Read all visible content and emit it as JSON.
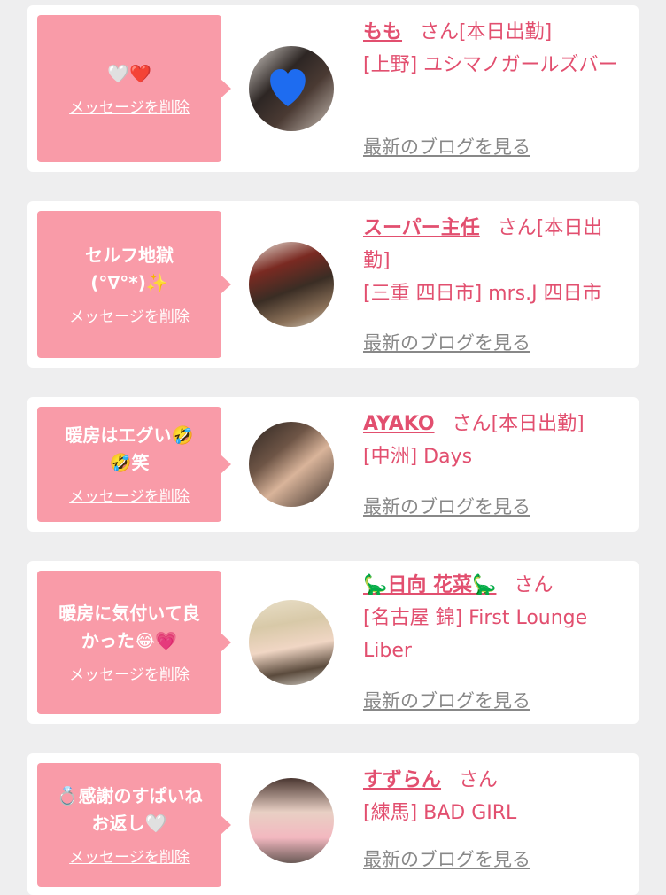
{
  "colors": {
    "bubble": "#f99ba8",
    "accent": "#e24f6f",
    "link_gray": "#888888",
    "background": "#eeeeef"
  },
  "delete_label": "メッセージを削除",
  "blog_label": "最新のブログを見る",
  "san": "さん",
  "entries": [
    {
      "message": "🤍❤️",
      "name": "もも",
      "status": "[本日出勤]",
      "shop": "[上野] ユシマノガールズバー"
    },
    {
      "message": "セルフ地獄\n(°∇°*)✨",
      "name": "スーパー主任",
      "status": "[本日出勤]",
      "shop": "[三重 四日市] mrs.J 四日市"
    },
    {
      "message": "暖房はエグい🤣\n🤣笑",
      "name": "AYAKO",
      "status": "[本日出勤]",
      "shop": "[中洲] Days"
    },
    {
      "message": "暖房に気付いて良\nかった😂💗",
      "name": "🦕日向 花菜🦕",
      "status": "",
      "shop": "[名古屋 錦] First Lounge Liber"
    },
    {
      "message": "💍感謝のすぱいね\nお返し🤍",
      "name": "すずらん",
      "status": "",
      "shop": "[練馬] BAD GIRL"
    }
  ]
}
